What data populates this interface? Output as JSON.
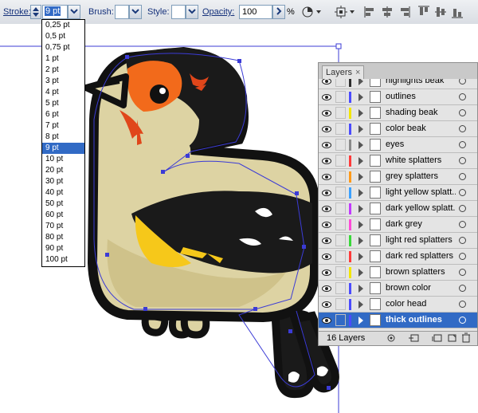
{
  "control_bar": {
    "stroke_label": "Stroke:",
    "stroke_value": "9 pt",
    "brush_label": "Brush:",
    "style_label": "Style:",
    "opacity_label": "Opacity:",
    "opacity_value": "100",
    "percent": "%"
  },
  "stroke_options": [
    "0,25 pt",
    "0,5 pt",
    "0,75 pt",
    "1 pt",
    "2 pt",
    "3 pt",
    "4 pt",
    "5 pt",
    "6 pt",
    "7 pt",
    "8 pt",
    "9 pt",
    "10 pt",
    "20 pt",
    "30 pt",
    "40 pt",
    "50 pt",
    "60 pt",
    "70 pt",
    "80 pt",
    "90 pt",
    "100 pt"
  ],
  "stroke_selected": "9 pt",
  "layers_panel": {
    "tab_label": "Layers",
    "close_glyph": "×",
    "count_label": "16 Layers",
    "layers": [
      {
        "name": "highlights beak",
        "color": "#2d2d2d"
      },
      {
        "name": "outlines",
        "color": "#4b4bff"
      },
      {
        "name": "shading beak",
        "color": "#f2e600"
      },
      {
        "name": "color beak",
        "color": "#4b4bff"
      },
      {
        "name": "eyes",
        "color": "#8a8a8a"
      },
      {
        "name": "white splatters",
        "color": "#ff3a3a"
      },
      {
        "name": "grey splatters",
        "color": "#ff9a1a"
      },
      {
        "name": "light yellow splatt...",
        "color": "#3aa0ff"
      },
      {
        "name": "dark yellow splatt...",
        "color": "#c23aff"
      },
      {
        "name": "dark grey",
        "color": "#ff4ad8"
      },
      {
        "name": "light red splatters",
        "color": "#39d839"
      },
      {
        "name": "dark red splatters",
        "color": "#ff3a3a"
      },
      {
        "name": "brown splatters",
        "color": "#f2e600"
      },
      {
        "name": "brown color",
        "color": "#4b4bff"
      },
      {
        "name": "color head",
        "color": "#4b4bff"
      },
      {
        "name": "thick outlines",
        "color": "#4b4bff",
        "selected": true
      }
    ]
  },
  "colors": {
    "selection_blue": "#316ac5",
    "path_blue": "#3b3bd6",
    "bird_body": "#ddd3a3",
    "bird_black": "#1a1a1a",
    "face_orange": "#f26a1b",
    "wing_yellow": "#f6c81a"
  }
}
